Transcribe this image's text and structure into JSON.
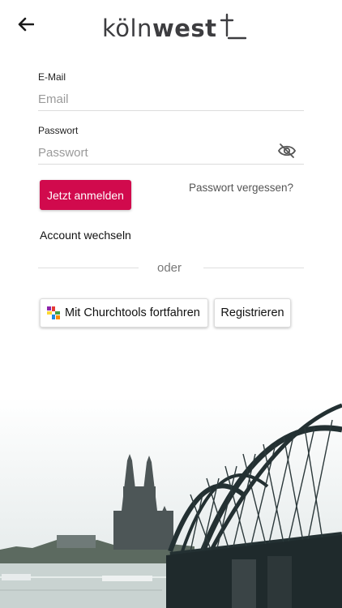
{
  "header": {
    "logo_text_light": "köln",
    "logo_text_bold": "west",
    "back_icon": "arrow-left-icon"
  },
  "form": {
    "email_label": "E-Mail",
    "email_placeholder": "Email",
    "email_value": "",
    "password_label": "Passwort",
    "password_placeholder": "Passwort",
    "password_value": "",
    "visibility_icon": "eye-off-icon",
    "login_button": "Jetzt anmelden",
    "forgot_link": "Passwort vergessen?",
    "switch_account": "Account wechseln"
  },
  "divider": {
    "text": "oder"
  },
  "alt_actions": {
    "churchtools_button": "Mit Churchtools fortfahren",
    "churchtools_icon": "churchtools-icon",
    "register_button": "Registrieren"
  },
  "colors": {
    "accent": "#d10a4d",
    "text": "#111111"
  }
}
